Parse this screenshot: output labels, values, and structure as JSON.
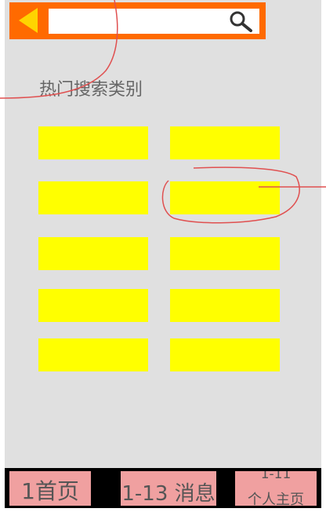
{
  "header": {
    "back_icon": "back-arrow-icon",
    "search": {
      "value": "",
      "placeholder": ""
    },
    "search_icon": "magnifier-icon",
    "bar_color": "#ff6a00",
    "accent_color": "#ffd400"
  },
  "section": {
    "title": "热门搜索类别"
  },
  "categories": {
    "count": 10,
    "color": "#ffff00"
  },
  "tabbar": {
    "tabs": [
      {
        "label": "1首页"
      },
      {
        "label": "1-13 消息"
      },
      {
        "id": "1-11",
        "label": "个人主页"
      }
    ],
    "tab_color": "#f0a0a0"
  },
  "annotations": {
    "color": "#e05050"
  }
}
